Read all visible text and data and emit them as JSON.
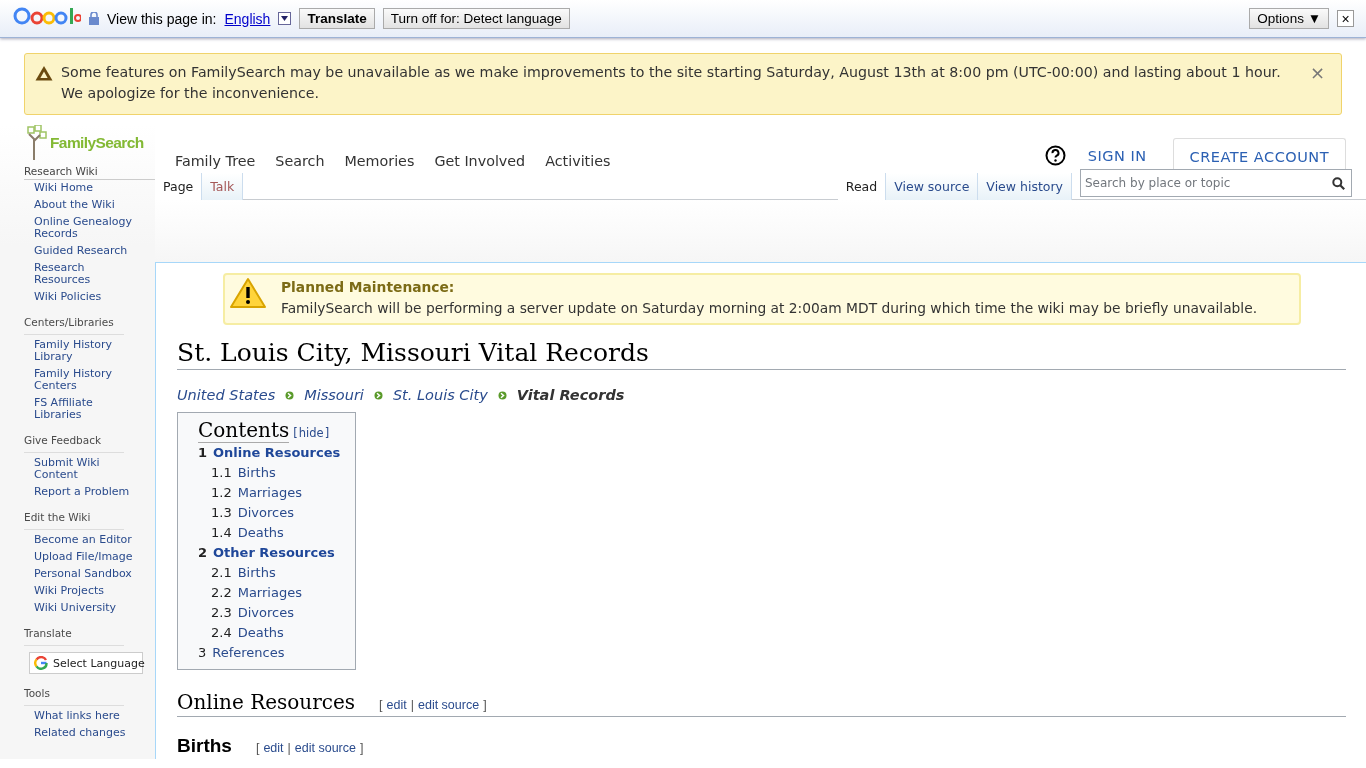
{
  "translate_bar": {
    "prompt": "View this page in:",
    "language": "English",
    "buttons": [
      "Translate",
      "Turn off for: Detect language"
    ],
    "options": "Options ▼",
    "close": "×"
  },
  "notice": {
    "text": "Some features on FamilySearch may be unavailable as we make improvements to the site starting Saturday, August 13th at 8:00 pm (UTC-00:00) and lasting about 1 hour. We apologize for the inconvenience.",
    "close": "×"
  },
  "header": {
    "nav": [
      "Family Tree",
      "Search",
      "Memories",
      "Get Involved",
      "Activities"
    ],
    "sign_in": "SIGN IN",
    "create_account": "CREATE ACCOUNT"
  },
  "sidebar": {
    "logo": "FamilySearch",
    "title": "Research Wiki",
    "groups": [
      {
        "items": [
          "Wiki Home",
          "About the Wiki",
          "Online Genealogy Records",
          "Guided Research",
          "Research Resources",
          "Wiki Policies"
        ]
      },
      {
        "heading": "Centers/Libraries",
        "items": [
          "Family History Library",
          "Family History Centers",
          "FS Affiliate Libraries"
        ]
      },
      {
        "heading": "Give Feedback",
        "items": [
          "Submit Wiki Content",
          "Report a Problem"
        ]
      },
      {
        "heading": "Edit the Wiki",
        "items": [
          "Become an Editor",
          "Upload File/Image",
          "Personal Sandbox",
          "Wiki Projects",
          "Wiki University"
        ]
      },
      {
        "heading": "Translate",
        "kind": "translate",
        "button": "Select Language"
      },
      {
        "heading": "Tools",
        "items": [
          "What links here",
          "Related changes"
        ]
      }
    ]
  },
  "left_tabs": [
    {
      "label": "Page",
      "selected": true
    },
    {
      "label": "Talk",
      "selected": false
    }
  ],
  "right_tabs": [
    {
      "label": "Read",
      "selected": true
    },
    {
      "label": "View source",
      "selected": false
    },
    {
      "label": "View history",
      "selected": false
    }
  ],
  "search": {
    "placeholder": "Search by place or topic"
  },
  "maintenance": {
    "title": "Planned Maintenance:",
    "text": "FamilySearch will be performing a server update on Saturday morning at 2:00am MDT during which time the wiki may be briefly unavailable."
  },
  "page_title": "St. Louis City, Missouri Vital Records",
  "breadcrumb": [
    {
      "label": "United States",
      "current": false
    },
    {
      "label": "Missouri",
      "current": false
    },
    {
      "label": "St. Louis City",
      "current": false
    },
    {
      "label": "Vital Records",
      "current": true
    }
  ],
  "toc": {
    "title": "Contents",
    "open": "[",
    "hide": "hide",
    "close": "]",
    "items": [
      {
        "number": "1",
        "label": "Online Resources",
        "children": [
          {
            "number": "1.1",
            "label": "Births"
          },
          {
            "number": "1.2",
            "label": "Marriages"
          },
          {
            "number": "1.3",
            "label": "Divorces"
          },
          {
            "number": "1.4",
            "label": "Deaths"
          }
        ]
      },
      {
        "number": "2",
        "label": "Other Resources",
        "children": [
          {
            "number": "2.1",
            "label": "Births"
          },
          {
            "number": "2.2",
            "label": "Marriages"
          },
          {
            "number": "2.3",
            "label": "Divorces"
          },
          {
            "number": "2.4",
            "label": "Deaths"
          }
        ]
      },
      {
        "number": "3",
        "label": "References"
      }
    ]
  },
  "sections": [
    {
      "kind": "h2",
      "title": "Online Resources",
      "open": "[",
      "edit": "edit",
      "separator": "|",
      "edit_source": "edit source",
      "close": "]"
    },
    {
      "kind": "h3",
      "title": "Births",
      "open": "[",
      "edit": "edit",
      "separator": "|",
      "edit_source": "edit source",
      "close": "]"
    }
  ]
}
